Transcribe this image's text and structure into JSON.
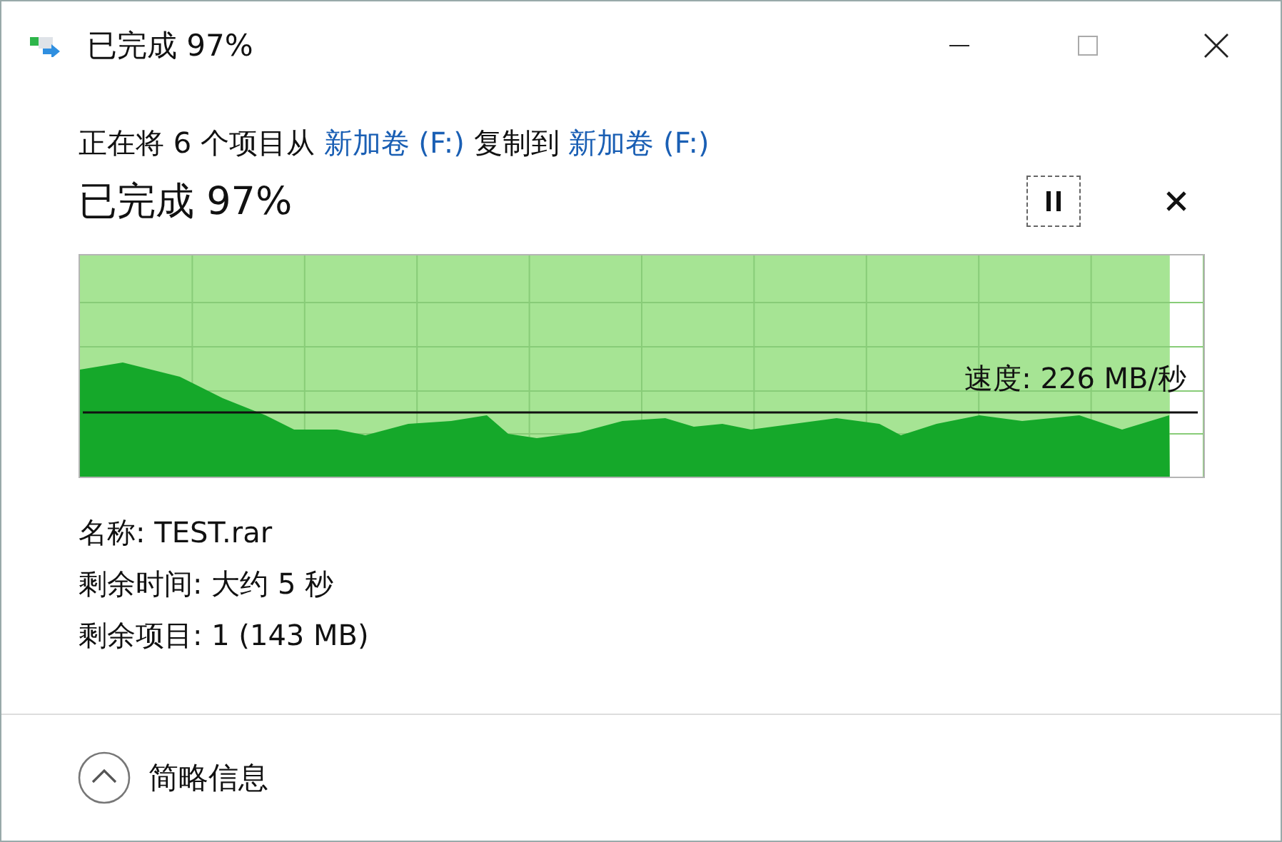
{
  "window": {
    "title": "已完成 97%"
  },
  "copy_line": {
    "prefix": "正在将 6 个项目从",
    "source": "新加卷 (F:)",
    "middle": "复制到",
    "destination": "新加卷 (F:)"
  },
  "heading": "已完成 97%",
  "progress": {
    "level": 0.97,
    "speed": "速度: 226 MB/秒"
  },
  "details": [
    {
      "label": "名称:",
      "value": "TEST.rar"
    },
    {
      "label": "剩余时间:",
      "value": "大约 5 秒"
    },
    {
      "label": "剩余项目:",
      "value": "1 (143 MB)"
    }
  ],
  "footer": {
    "toggle": "简略信息",
    "expanded": true
  }
}
